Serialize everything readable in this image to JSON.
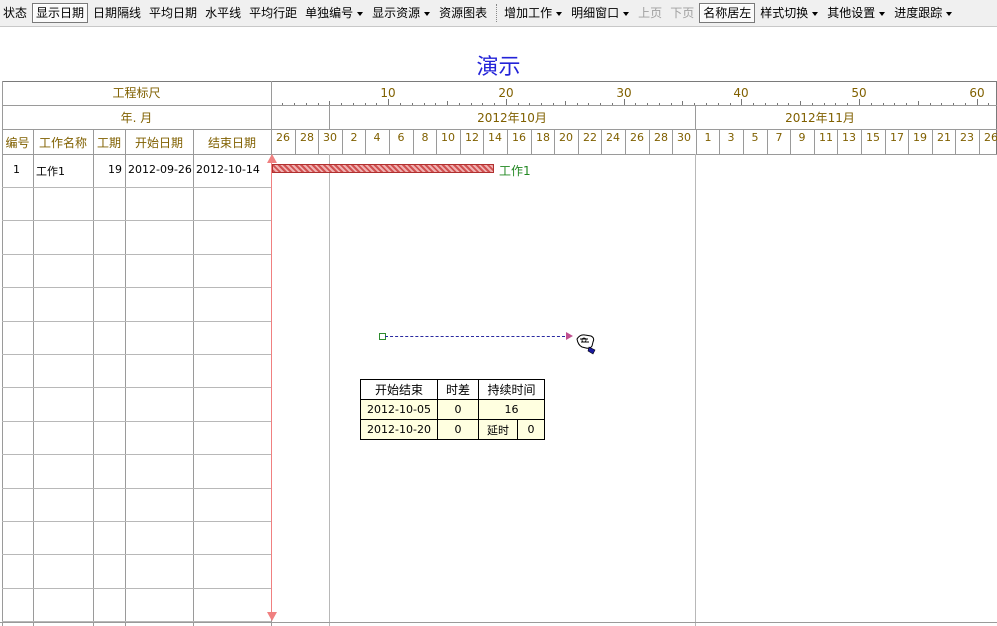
{
  "toolbar": {
    "items": [
      {
        "label": "状态",
        "dropdown": false,
        "pressed": false,
        "disabled": false
      },
      {
        "label": "显示日期",
        "dropdown": false,
        "pressed": true,
        "disabled": false
      },
      {
        "label": "日期隔线",
        "dropdown": false,
        "pressed": false,
        "disabled": false
      },
      {
        "label": "平均日期",
        "dropdown": false,
        "pressed": false,
        "disabled": false
      },
      {
        "label": "水平线",
        "dropdown": false,
        "pressed": false,
        "disabled": false
      },
      {
        "label": "平均行距",
        "dropdown": false,
        "pressed": false,
        "disabled": false
      },
      {
        "label": "单独编号",
        "dropdown": true,
        "pressed": false,
        "disabled": false
      },
      {
        "label": "显示资源",
        "dropdown": true,
        "pressed": false,
        "disabled": false
      },
      {
        "label": "资源图表",
        "dropdown": false,
        "pressed": false,
        "disabled": false
      },
      {
        "label": "增加工作",
        "dropdown": true,
        "pressed": false,
        "disabled": false,
        "sep_before": true
      },
      {
        "label": "明细窗口",
        "dropdown": true,
        "pressed": false,
        "disabled": false
      },
      {
        "label": "上页",
        "dropdown": false,
        "pressed": false,
        "disabled": true
      },
      {
        "label": "下页",
        "dropdown": false,
        "pressed": false,
        "disabled": true
      },
      {
        "label": "名称居左",
        "dropdown": false,
        "pressed": true,
        "disabled": false
      },
      {
        "label": "样式切换",
        "dropdown": true,
        "pressed": false,
        "disabled": false
      },
      {
        "label": "其他设置",
        "dropdown": true,
        "pressed": false,
        "disabled": false
      },
      {
        "label": "进度跟踪",
        "dropdown": true,
        "pressed": false,
        "disabled": false
      }
    ]
  },
  "title": "演示",
  "header": {
    "scale_label": "工程标尺",
    "year_month_label": "年. 月",
    "columns": [
      "编号",
      "工作名称",
      "工期",
      "开始日期",
      "结束日期"
    ],
    "scale_ticks": [
      "10",
      "20",
      "30",
      "40",
      "50",
      "60"
    ],
    "months": [
      "2012年10月",
      "2012年11月"
    ],
    "days": [
      "26",
      "28",
      "30",
      "2",
      "4",
      "6",
      "8",
      "10",
      "12",
      "14",
      "16",
      "18",
      "20",
      "22",
      "24",
      "26",
      "28",
      "30",
      "1",
      "3",
      "5",
      "7",
      "9",
      "11",
      "13",
      "15",
      "17",
      "19",
      "21",
      "23",
      "26"
    ]
  },
  "rows": [
    {
      "id": "1",
      "name": "工作1",
      "duration": "19",
      "start": "2012-09-26",
      "end": "2012-10-14",
      "bar_label": "工作1"
    }
  ],
  "popup": {
    "headers": [
      "开始结束",
      "时差",
      "持续时间"
    ],
    "row1": {
      "date": "2012-10-05",
      "slack": "0",
      "duration": "16"
    },
    "row2": {
      "date": "2012-10-20",
      "slack": "0",
      "delay_label": "延时",
      "delay": "0"
    }
  },
  "colors": {
    "title": "#2323d8",
    "header_text": "#806000",
    "bar": "#d05050",
    "bar_label": "#228822",
    "today_line": "#f08080"
  }
}
